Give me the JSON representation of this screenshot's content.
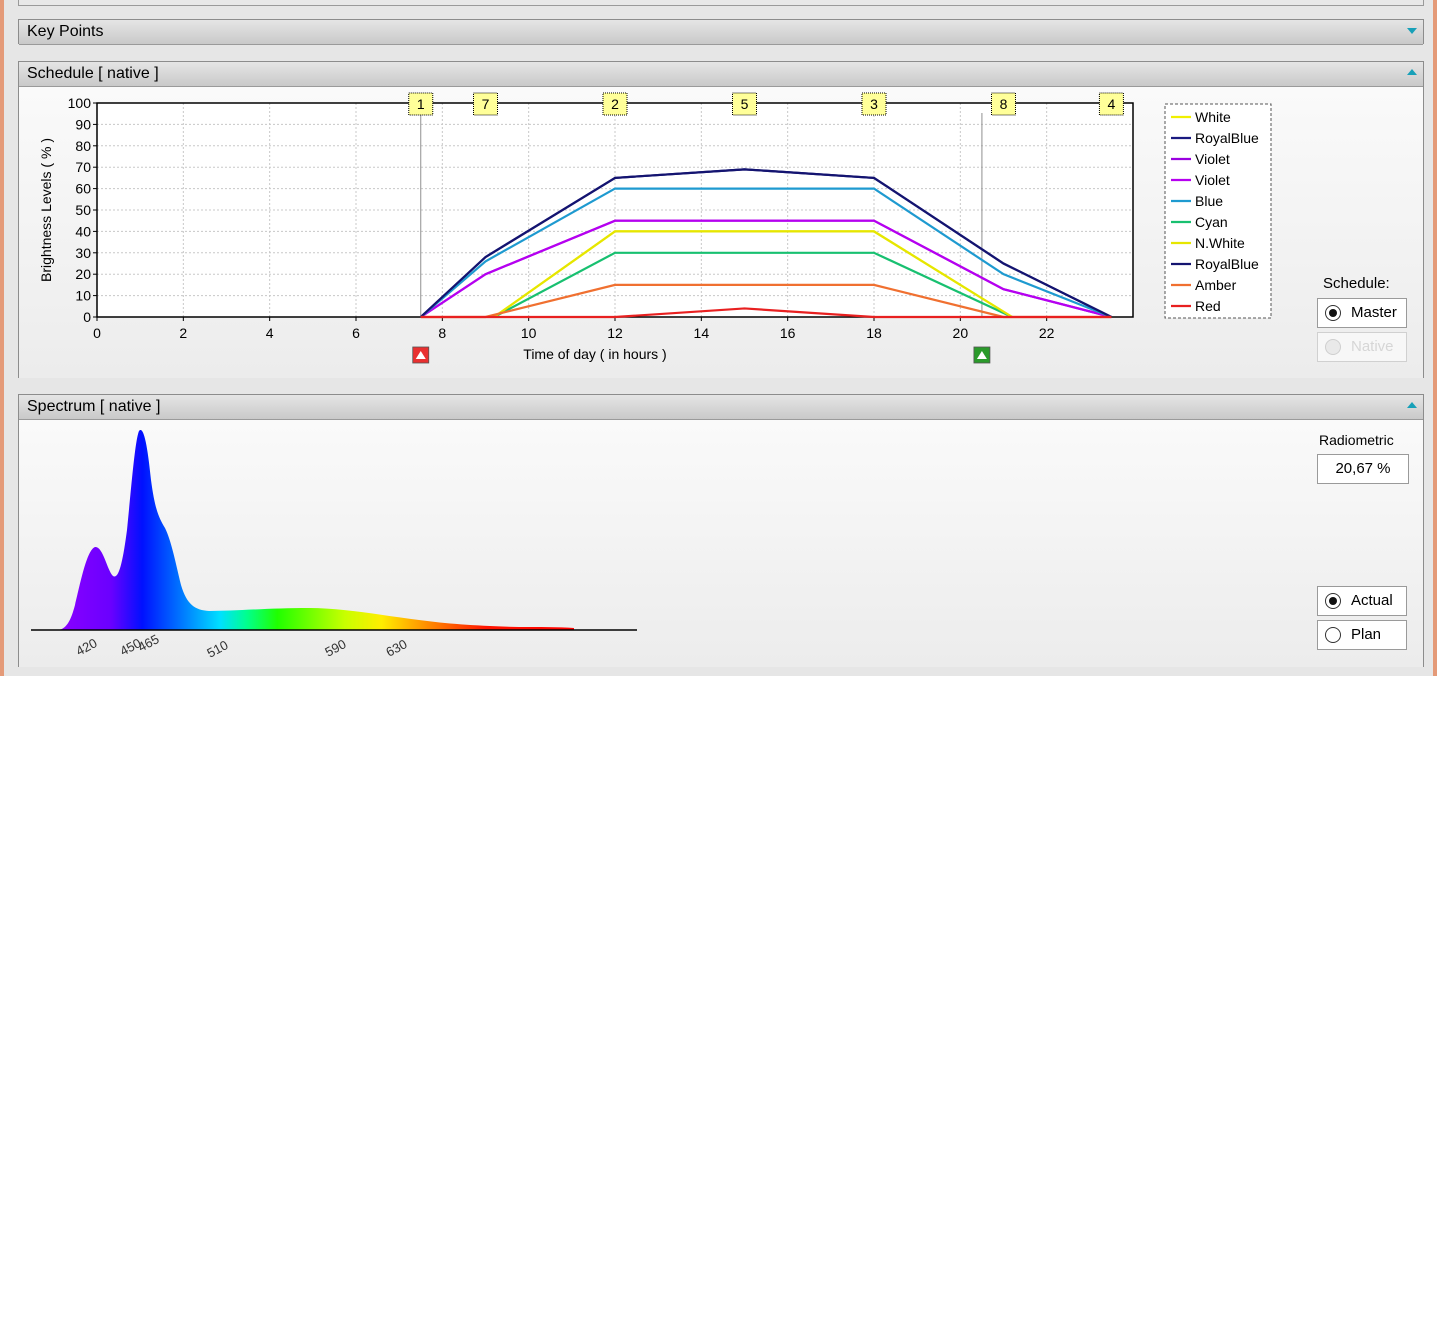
{
  "key_points": {
    "title": "Key Points"
  },
  "schedule": {
    "title": "Schedule  [ native ]",
    "ylabel": "Brightness Levels  ( % )",
    "xlabel": "Time of day  ( in hours )",
    "schedule_label": "Schedule:",
    "master_label": "Master",
    "native_label": "Native",
    "master_selected": true
  },
  "spectrum": {
    "title": "Spectrum  [ native ]",
    "radiometric_label": "Radiometric",
    "radiometric_value": "20,67 %",
    "actual_label": "Actual",
    "plan_label": "Plan",
    "actual_selected": true,
    "ticks": [
      "420",
      "450",
      "465",
      "510",
      "590",
      "630"
    ]
  },
  "chart_data": {
    "type": "line",
    "xlim": [
      0,
      24
    ],
    "ylim": [
      0,
      100
    ],
    "xticks": [
      "0",
      "2",
      "4",
      "6",
      "8",
      "10",
      "12",
      "14",
      "16",
      "18",
      "20",
      "22"
    ],
    "yticks": [
      "0",
      "10",
      "20",
      "30",
      "40",
      "50",
      "60",
      "70",
      "80",
      "90",
      "100"
    ],
    "grid": true,
    "legend_position": "right",
    "sunrise": 7.5,
    "sunset": 20.5,
    "markers": [
      {
        "label": "1",
        "x": 7.5
      },
      {
        "label": "7",
        "x": 9
      },
      {
        "label": "2",
        "x": 12
      },
      {
        "label": "5",
        "x": 15
      },
      {
        "label": "3",
        "x": 18
      },
      {
        "label": "8",
        "x": 21
      },
      {
        "label": "4",
        "x": 23.5
      }
    ],
    "series": [
      {
        "name": "White",
        "color": "#f0f000",
        "x": [
          9.2,
          12,
          18,
          21.2
        ],
        "y": [
          0,
          40,
          40,
          0
        ]
      },
      {
        "name": "RoyalBlue",
        "color": "#1a1a80",
        "x": [
          7.5,
          9,
          12,
          15,
          18,
          21,
          23.5
        ],
        "y": [
          0,
          28,
          65,
          69,
          65,
          25,
          0
        ]
      },
      {
        "name": "Violet",
        "color": "#9a00e0",
        "x": [
          7.5,
          9,
          12,
          18,
          21,
          23.5
        ],
        "y": [
          0,
          20,
          45,
          45,
          13,
          0
        ]
      },
      {
        "name": "Violet",
        "color": "#b600f0",
        "x": [
          7.5,
          9,
          12,
          18,
          21,
          23.5
        ],
        "y": [
          0,
          20,
          45,
          45,
          13,
          0
        ]
      },
      {
        "name": "Blue",
        "color": "#1e9ad0",
        "x": [
          7.5,
          9,
          12,
          18,
          21,
          23.5
        ],
        "y": [
          0,
          26,
          60,
          60,
          20,
          0
        ]
      },
      {
        "name": "Cyan",
        "color": "#18c070",
        "x": [
          9.2,
          12,
          18,
          21.2
        ],
        "y": [
          0,
          30,
          30,
          0
        ]
      },
      {
        "name": "N.White",
        "color": "#e6e600",
        "x": [
          9.2,
          12,
          18,
          21.2
        ],
        "y": [
          0,
          40,
          40,
          0
        ]
      },
      {
        "name": "RoyalBlue",
        "color": "#141470",
        "x": [
          7.5,
          9,
          12,
          15,
          18,
          21,
          23.5
        ],
        "y": [
          0,
          28,
          65,
          69,
          65,
          25,
          0
        ]
      },
      {
        "name": "Amber",
        "color": "#f07030",
        "x": [
          7.5,
          9,
          12,
          18,
          21,
          23.5
        ],
        "y": [
          0,
          0,
          15,
          15,
          0,
          0
        ]
      },
      {
        "name": "Red",
        "color": "#e82020",
        "x": [
          7.5,
          12,
          15,
          18,
          23.5
        ],
        "y": [
          0,
          0,
          4,
          0,
          0
        ]
      }
    ]
  }
}
